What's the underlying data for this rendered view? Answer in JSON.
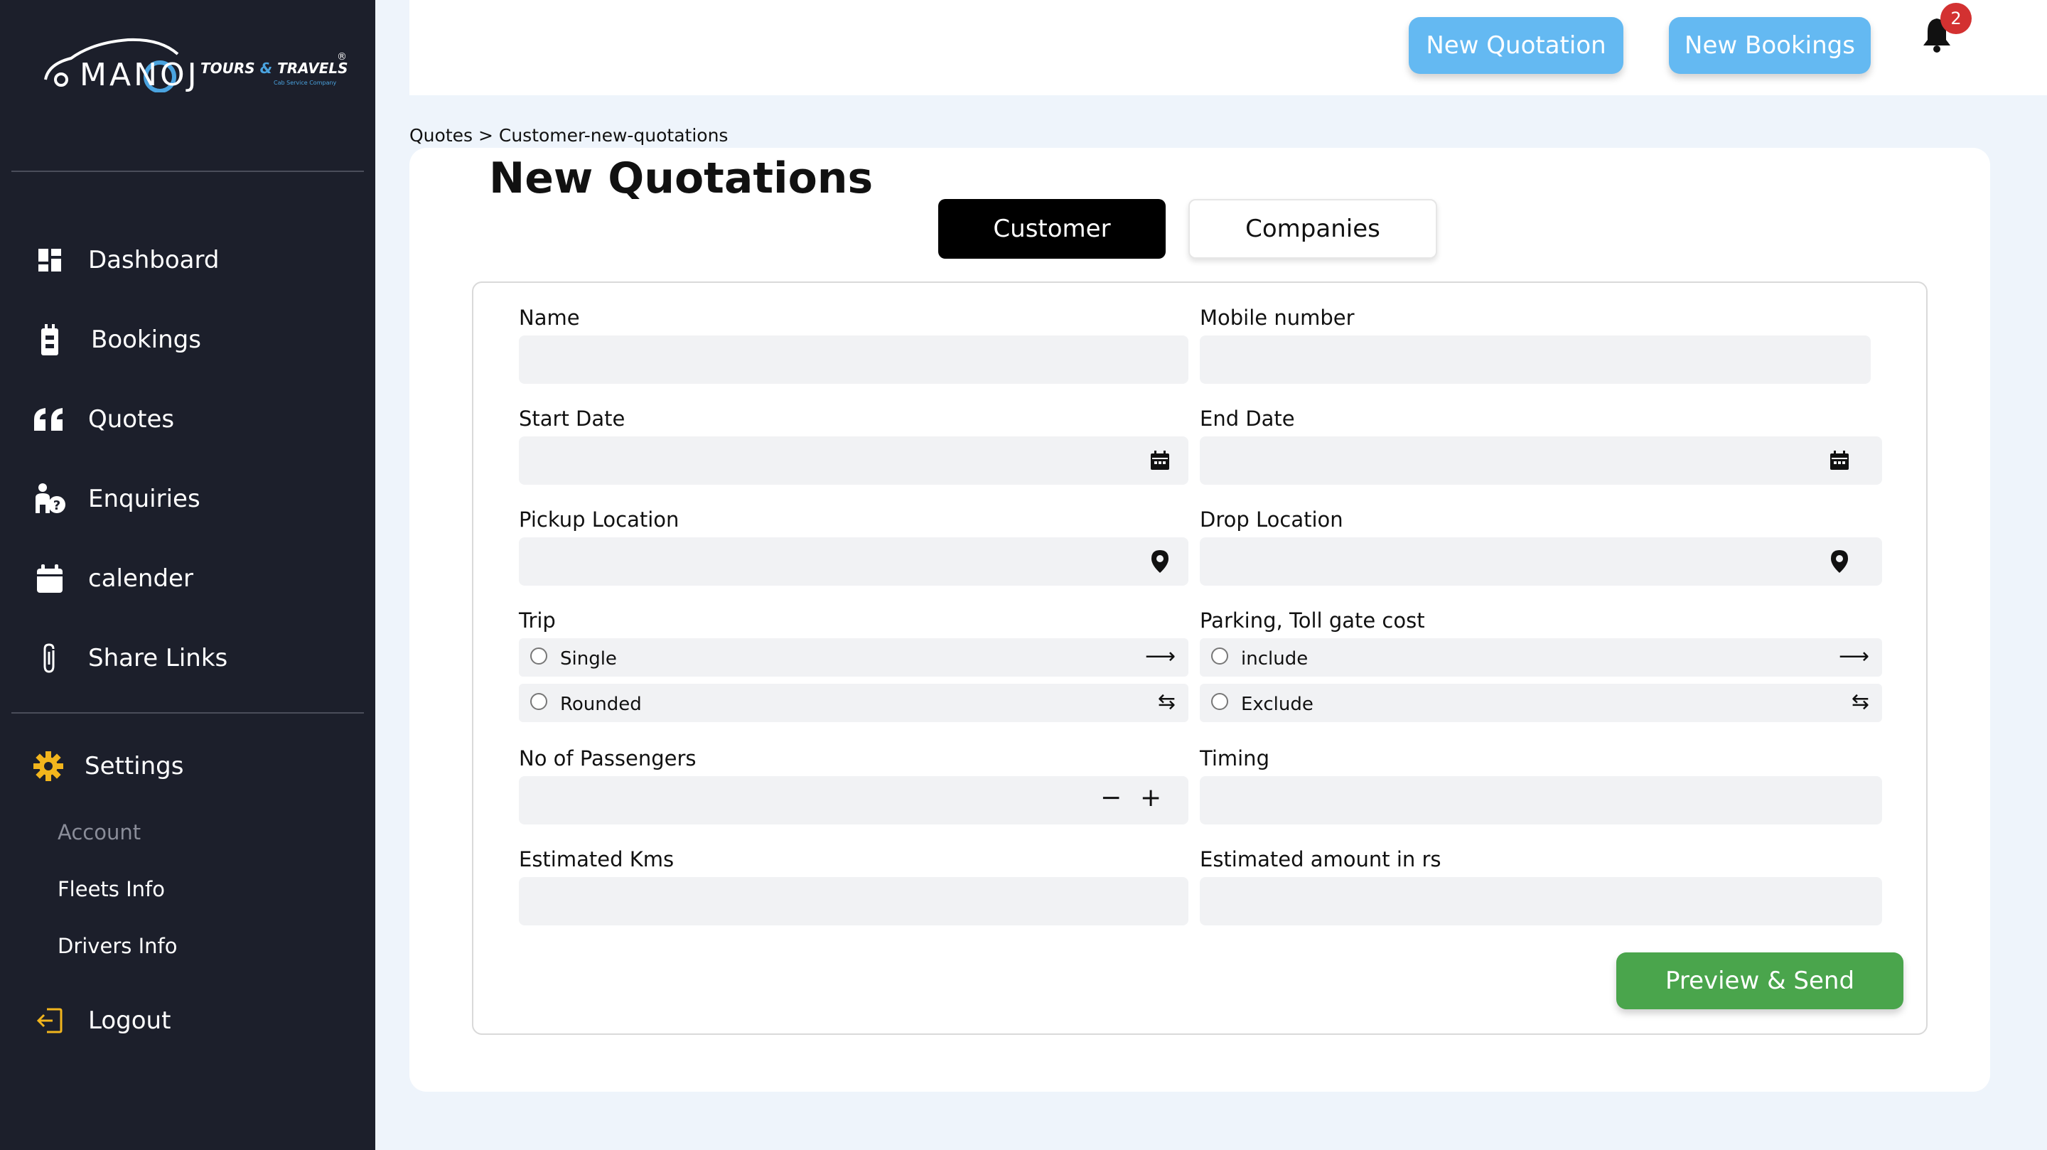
{
  "brand": {
    "name": "MANOJ",
    "tagline_left": "TOURS",
    "tagline_amp": "&",
    "tagline_right": "TRAVELS",
    "subtitle": "Cab Service Company",
    "registered": "®"
  },
  "sidebar": {
    "items": [
      {
        "label": "Dashboard",
        "icon": "dashboard-icon"
      },
      {
        "label": "Bookings",
        "icon": "booking-icon"
      },
      {
        "label": "Quotes",
        "icon": "quote-icon"
      },
      {
        "label": "Enquiries",
        "icon": "enquiry-icon"
      },
      {
        "label": "calender",
        "icon": "calendar-icon"
      },
      {
        "label": "Share Links",
        "icon": "paperclip-icon"
      }
    ],
    "settings": {
      "label": "Settings",
      "icon": "gear-icon"
    },
    "settings_sub": [
      {
        "label": "Account"
      },
      {
        "label": "Fleets Info"
      },
      {
        "label": "Drivers Info"
      }
    ],
    "logout": {
      "label": "Logout",
      "icon": "logout-icon"
    }
  },
  "topbar": {
    "new_quotation": "New Quotation",
    "new_bookings": "New Bookings",
    "notification_count": "2"
  },
  "breadcrumb": "Quotes > Customer-new-quotations",
  "page": {
    "title": "New Quotations",
    "tabs": {
      "customer": "Customer",
      "companies": "Companies",
      "active": "Customer"
    }
  },
  "form": {
    "name": {
      "label": "Name",
      "value": ""
    },
    "mobile": {
      "label": "Mobile number",
      "value": ""
    },
    "start_date": {
      "label": "Start Date",
      "value": ""
    },
    "end_date": {
      "label": "End Date",
      "value": ""
    },
    "pickup": {
      "label": "Pickup Location",
      "value": ""
    },
    "drop": {
      "label": "Drop Location",
      "value": ""
    },
    "trip": {
      "label": "Trip",
      "options": [
        "Single",
        "Rounded"
      ]
    },
    "parking": {
      "label": "Parking, Toll gate cost",
      "options": [
        "include",
        "Exclude"
      ]
    },
    "passengers": {
      "label": "No of Passengers",
      "value": "",
      "minus": "−",
      "plus": "+"
    },
    "timing": {
      "label": "Timing",
      "value": ""
    },
    "est_kms": {
      "label": "Estimated Kms",
      "value": ""
    },
    "est_amount": {
      "label": "Estimated amount in rs",
      "value": ""
    },
    "submit": "Preview & Send"
  },
  "colors": {
    "sidebar": "#1c1f2b",
    "top_button": "#64b9f2",
    "submit": "#4aa54c",
    "badge": "#d33131",
    "gear": "#f2b51d"
  }
}
